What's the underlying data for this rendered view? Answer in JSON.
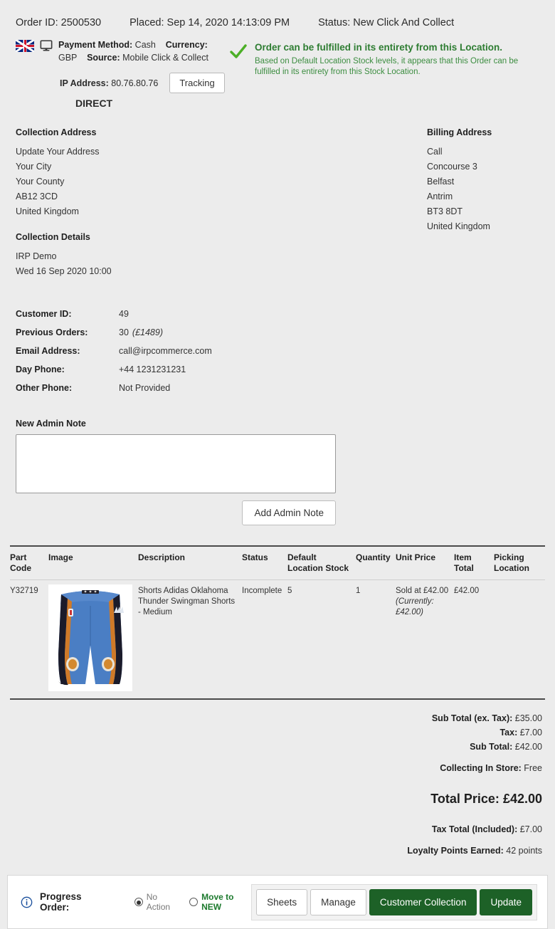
{
  "header": {
    "order_id_label": "Order ID:",
    "order_id": "2500530",
    "placed_label": "Placed:",
    "placed": "Sep 14, 2020 14:13:09 PM",
    "status_label": "Status:",
    "status": "New Click And Collect"
  },
  "meta": {
    "flag_icon": "uk-flag-icon",
    "device_icon": "desktop-monitor-icon",
    "payment_method_label": "Payment Method:",
    "payment_method": "Cash",
    "currency_label": "Currency:",
    "currency": "GBP",
    "source_label": "Source:",
    "source": "Mobile Click & Collect",
    "ip_label": "IP Address:",
    "ip": "80.76.80.76",
    "tracking_button": "Tracking",
    "direct": "DIRECT"
  },
  "fulfilment": {
    "icon": "green-check-icon",
    "title": "Order can be fulfilled in its entirety from this Location.",
    "detail": "Based on Default Location Stock levels, it appears that this Order can be fulfilled in its entirety from this Stock Location.",
    "color": "#2e7d32"
  },
  "collection_address": {
    "title": "Collection Address",
    "lines": [
      "Update Your Address",
      "Your City",
      "Your County",
      "AB12 3CD",
      "United Kingdom"
    ]
  },
  "collection_details": {
    "title": "Collection Details",
    "lines": [
      "IRP Demo",
      "Wed 16 Sep 2020 10:00"
    ]
  },
  "billing_address": {
    "title": "Billing Address",
    "lines": [
      "Call",
      "Concourse 3",
      "Belfast",
      "Antrim",
      "BT3 8DT",
      "United Kingdom"
    ]
  },
  "customer": {
    "rows": [
      {
        "key": "Customer ID:",
        "value": "49",
        "note": ""
      },
      {
        "key": "Previous Orders:",
        "value": "30",
        "note": "(£1489)"
      },
      {
        "key": "Email Address:",
        "value": "call@irpcommerce.com",
        "note": ""
      },
      {
        "key": "Day Phone:",
        "value": "+44 1231231231",
        "note": ""
      },
      {
        "key": "Other Phone:",
        "value": "Not Provided",
        "note": ""
      }
    ]
  },
  "admin_note": {
    "label": "New Admin Note",
    "value": "",
    "placeholder": "",
    "button": "Add Admin Note"
  },
  "products": {
    "columns": [
      "Part Code",
      "Image",
      "Description",
      "Status",
      "Default Location Stock",
      "Quantity",
      "Unit Price",
      "Item Total",
      "Picking Location"
    ],
    "rows": [
      {
        "part_code": "Y32719",
        "image_alt": "basketball-shorts-image",
        "description": "Shorts Adidas Oklahoma Thunder Swingman Shorts - Medium",
        "status": "Incomplete",
        "default_location_stock": "5",
        "quantity": "1",
        "unit_price": "Sold at £42.00",
        "unit_price_note": "(Currently: £42.00)",
        "item_total": "£42.00",
        "picking_location": ""
      }
    ]
  },
  "totals": {
    "rows": [
      {
        "label": "Sub Total (ex. Tax):",
        "value": "£35.00"
      },
      {
        "label": "Tax:",
        "value": "£7.00"
      },
      {
        "label": "Sub Total:",
        "value": "£42.00"
      }
    ],
    "shipping_label": "Collecting In Store:",
    "shipping_value": "Free",
    "grand_label": "Total Price:",
    "grand_value": "£42.00",
    "after_rows": [
      {
        "label": "Tax Total (Included):",
        "value": "£7.00"
      },
      {
        "label": "Loyalty Points Earned:",
        "value": "42 points"
      }
    ]
  },
  "footer": {
    "info_icon": "info-circle-icon",
    "progress_label": "Progress Order:",
    "options": [
      {
        "label": "No Action",
        "selected": true,
        "style": "muted"
      },
      {
        "label": "Move to NEW",
        "selected": false,
        "style": "green"
      }
    ],
    "buttons": [
      {
        "label": "Sheets",
        "primary": false
      },
      {
        "label": "Manage",
        "primary": false
      },
      {
        "label": "Customer Collection",
        "primary": true
      },
      {
        "label": "Update",
        "primary": true
      }
    ],
    "accent": "#1d6127"
  }
}
